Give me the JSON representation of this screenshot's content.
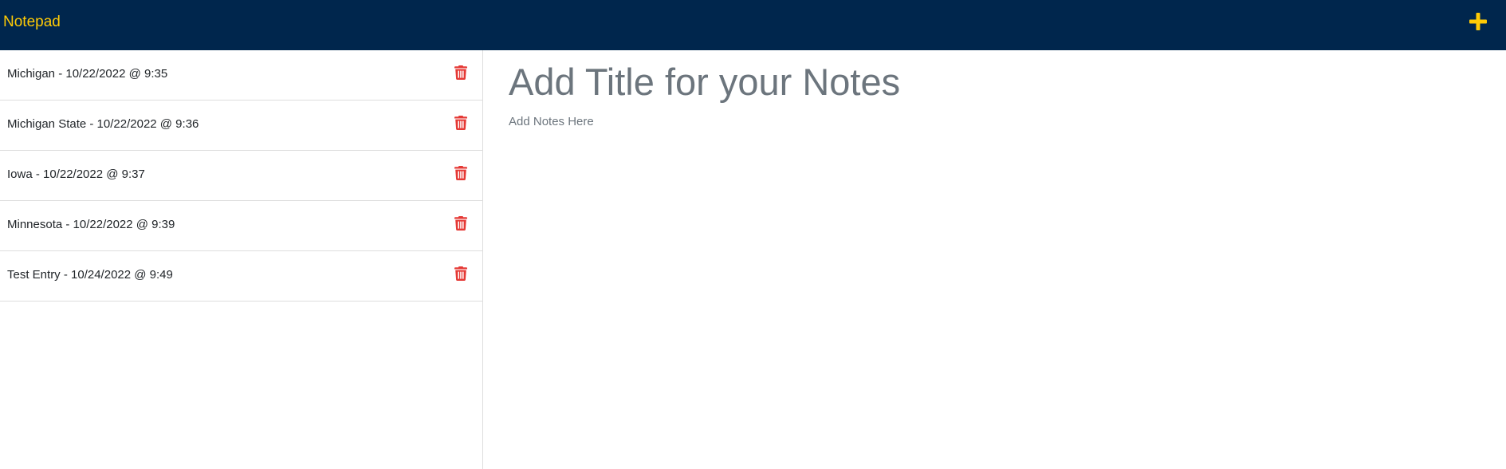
{
  "app": {
    "brand": "Notepad",
    "add_icon": "plus-icon"
  },
  "colors": {
    "navbar_bg": "#00264d",
    "brand_color": "#ffcb05",
    "delete_color": "#e53935"
  },
  "notes": [
    {
      "title": "Michigan - 10/22/2022 @ 9:35",
      "icon": "trash-icon"
    },
    {
      "title": "Michigan State - 10/22/2022 @ 9:36",
      "icon": "trash-icon"
    },
    {
      "title": "Iowa - 10/22/2022 @ 9:37",
      "icon": "trash-icon"
    },
    {
      "title": "Minnesota - 10/22/2022 @ 9:39",
      "icon": "trash-icon"
    },
    {
      "title": "Test Entry - 10/24/2022 @ 9:49",
      "icon": "trash-icon"
    }
  ],
  "editor": {
    "title_value": "",
    "title_placeholder": "Add Title for your Notes",
    "body_value": "",
    "body_placeholder": "Add Notes Here"
  }
}
